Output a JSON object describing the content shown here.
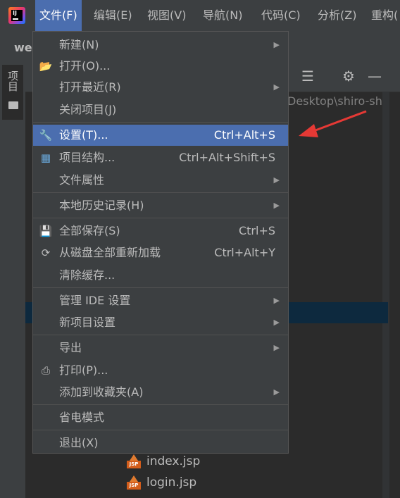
{
  "menubar": {
    "items": [
      "文件(F)",
      "编辑(E)",
      "视图(V)",
      "导航(N)",
      "代码(C)",
      "分析(Z)",
      "重构("
    ]
  },
  "project_label": "we",
  "side_tab_label": "项目",
  "path_fragment": "Desktop\\shiro-sh",
  "file_menu": [
    {
      "label": "新建(N)",
      "shortcut": "",
      "submenu": true,
      "icon": ""
    },
    {
      "label": "打开(O)...",
      "shortcut": "",
      "submenu": false,
      "icon": "folder-open-icon"
    },
    {
      "label": "打开最近(R)",
      "shortcut": "",
      "submenu": true,
      "icon": ""
    },
    {
      "label": "关闭项目(J)",
      "shortcut": "",
      "submenu": false,
      "icon": ""
    },
    {
      "label": "设置(T)...",
      "shortcut": "Ctrl+Alt+S",
      "submenu": false,
      "icon": "wrench-icon",
      "highlighted": true
    },
    {
      "label": "项目结构...",
      "shortcut": "Ctrl+Alt+Shift+S",
      "submenu": false,
      "icon": "project-structure-icon"
    },
    {
      "label": "文件属性",
      "shortcut": "",
      "submenu": true,
      "icon": ""
    },
    {
      "label": "本地历史记录(H)",
      "shortcut": "",
      "submenu": true,
      "icon": ""
    },
    {
      "label": "全部保存(S)",
      "shortcut": "Ctrl+S",
      "submenu": false,
      "icon": "save-icon"
    },
    {
      "label": "从磁盘全部重新加载",
      "shortcut": "Ctrl+Alt+Y",
      "submenu": false,
      "icon": "reload-icon"
    },
    {
      "label": "清除缓存...",
      "shortcut": "",
      "submenu": false,
      "icon": ""
    },
    {
      "label": "管理 IDE 设置",
      "shortcut": "",
      "submenu": true,
      "icon": ""
    },
    {
      "label": "新项目设置",
      "shortcut": "",
      "submenu": true,
      "icon": ""
    },
    {
      "label": "导出",
      "shortcut": "",
      "submenu": true,
      "icon": ""
    },
    {
      "label": "打印(P)...",
      "shortcut": "",
      "submenu": false,
      "icon": "printer-icon"
    },
    {
      "label": "添加到收藏夹(A)",
      "shortcut": "",
      "submenu": true,
      "icon": ""
    },
    {
      "label": "省电模式",
      "shortcut": "",
      "submenu": false,
      "icon": ""
    },
    {
      "label": "退出(X)",
      "shortcut": "",
      "submenu": false,
      "icon": ""
    }
  ],
  "files": [
    {
      "name": "index.jsp",
      "icon_label": "JSP"
    },
    {
      "name": "login.jsp",
      "icon_label": "JSP"
    }
  ],
  "colors": {
    "menu_highlight": "#4b6eaf",
    "annotation_arrow": "#e53935",
    "background": "#2b2b2b",
    "panel": "#3c3f41"
  }
}
